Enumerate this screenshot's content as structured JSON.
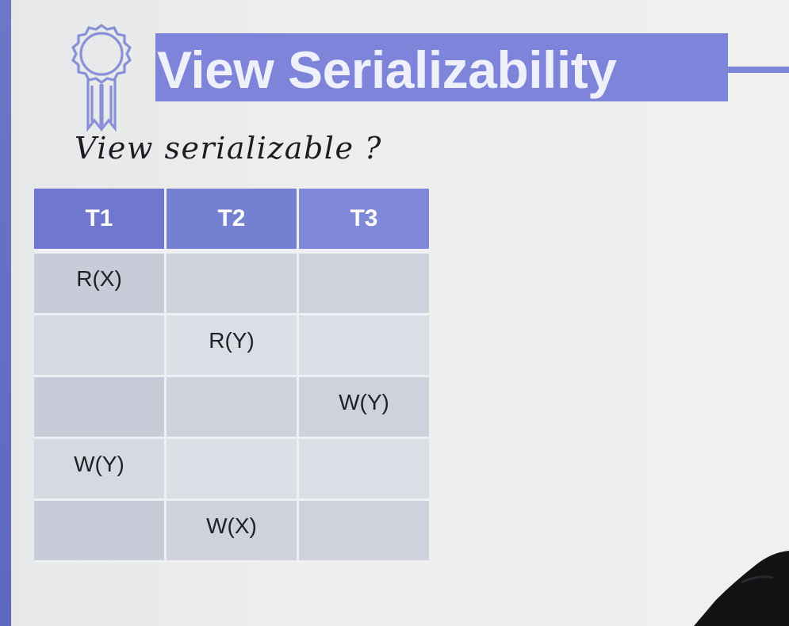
{
  "slide": {
    "title": "View Serializability",
    "handwritten_note": "View serializable ?",
    "accent_color": "#7f84db",
    "icon": "award-ribbon-icon"
  },
  "schedule": {
    "headers": [
      "T1",
      "T2",
      "T3"
    ],
    "rows": [
      [
        "R(X)",
        "",
        ""
      ],
      [
        "",
        "R(Y)",
        ""
      ],
      [
        "",
        "",
        "W(Y)"
      ],
      [
        "W(Y)",
        "",
        ""
      ],
      [
        "",
        "W(X)",
        ""
      ]
    ]
  }
}
